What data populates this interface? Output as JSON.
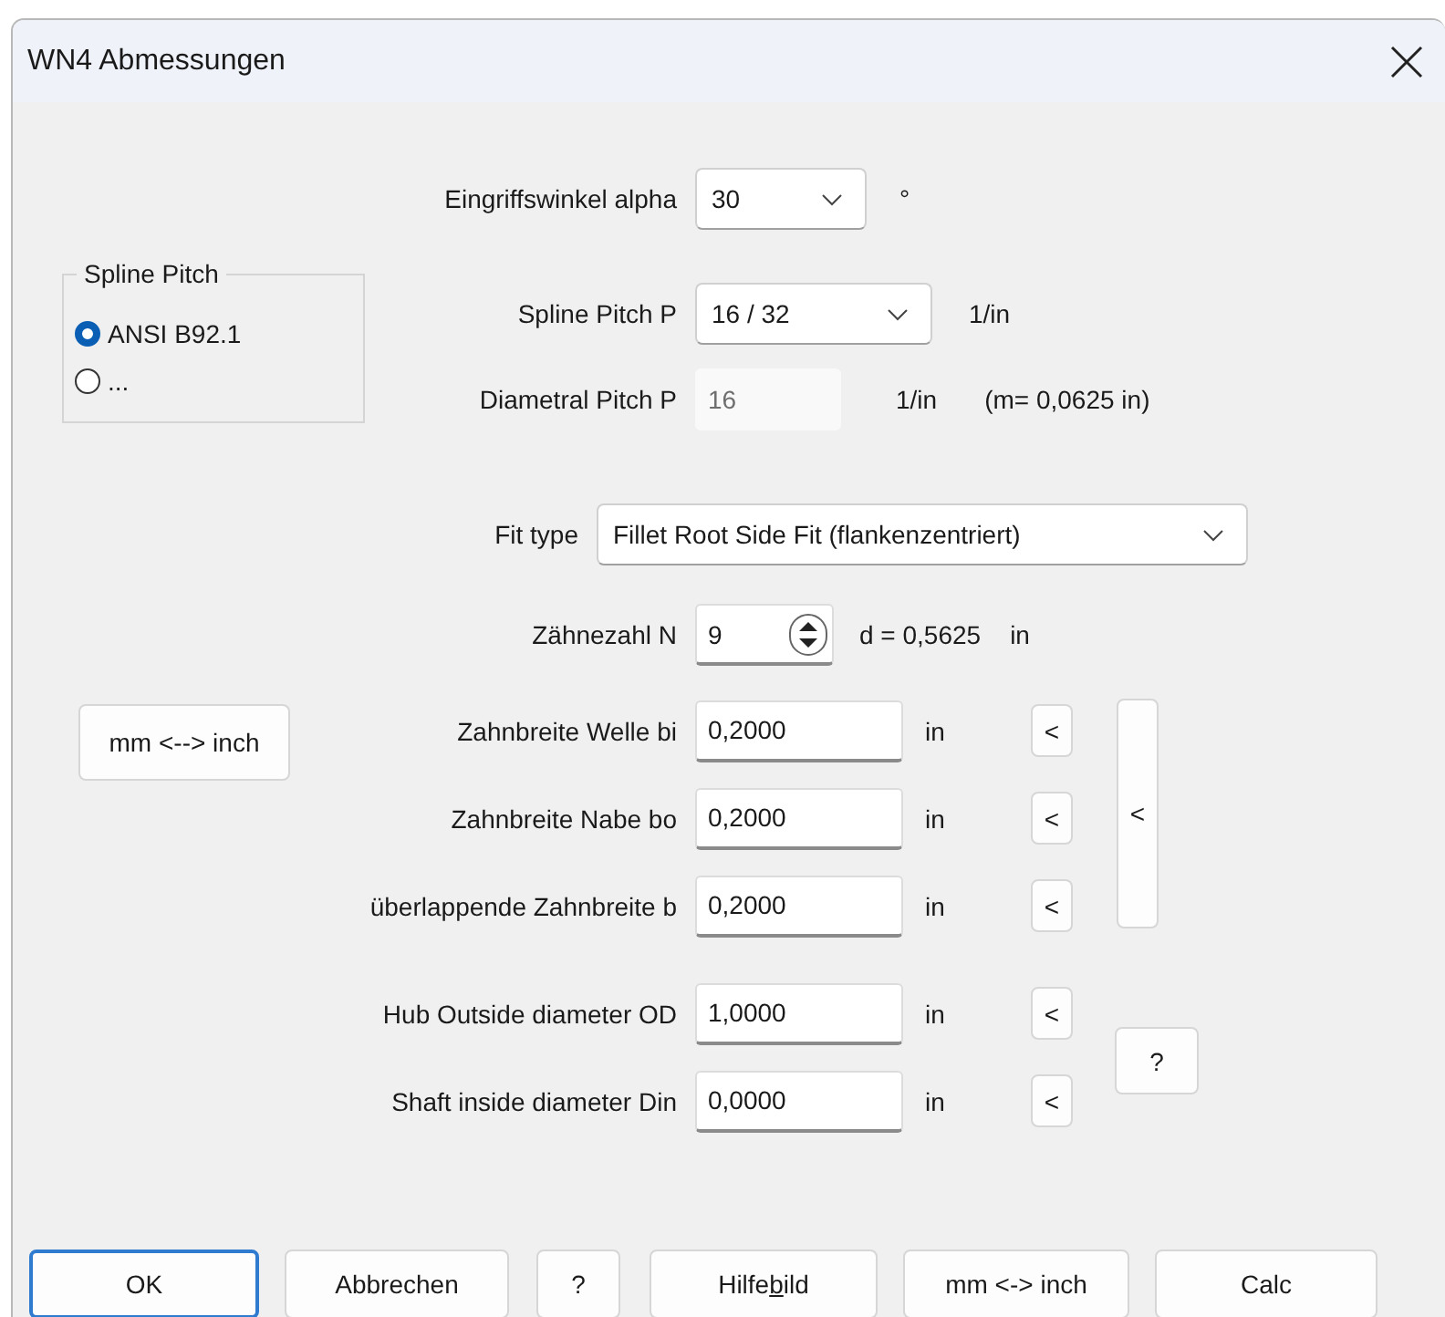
{
  "window": {
    "title": "WN4 Abmessungen"
  },
  "pressure_angle": {
    "label": "Eingriffswinkel alpha",
    "value": "30",
    "unit": "°"
  },
  "spline_pitch_group": {
    "title": "Spline Pitch",
    "options": [
      {
        "label": "ANSI B92.1",
        "selected": true
      },
      {
        "label": "...",
        "selected": false
      }
    ]
  },
  "spline_pitch": {
    "label": "Spline Pitch P",
    "value": "16 / 32",
    "unit": "1/in"
  },
  "diametral_pitch": {
    "label": "Diametral Pitch P",
    "value": "16",
    "disabled": true,
    "unit": "1/in",
    "module": "(m= 0,0625 in)"
  },
  "fit_type": {
    "label": "Fit type",
    "value": "Fillet Root Side Fit (flankenzentriert)"
  },
  "teeth": {
    "label": "Zähnezahl N",
    "value": "9",
    "diameter": "d = 0,5625",
    "unit": "in"
  },
  "convert_button": "mm <--> inch",
  "width_rows": [
    {
      "label": "Zahnbreite Welle bi",
      "value": "0,2000",
      "unit": "in",
      "button": "<"
    },
    {
      "label": "Zahnbreite Nabe bo",
      "value": "0,2000",
      "unit": "in",
      "button": "<"
    },
    {
      "label": "überlappende Zahnbreite b",
      "value": "0,2000",
      "unit": "in",
      "button": "<"
    }
  ],
  "copy_all_button": "<",
  "diameter_rows": [
    {
      "label": "Hub Outside diameter OD",
      "value": "1,0000",
      "unit": "in",
      "button": "<"
    },
    {
      "label": "Shaft inside diameter  Din",
      "value": "0,0000",
      "unit": "in",
      "button": "<"
    }
  ],
  "help_button": "?",
  "buttons": [
    {
      "kind": "plain",
      "label": "OK",
      "default": true
    },
    {
      "kind": "plain",
      "label": "Abbrechen",
      "default": false
    },
    {
      "kind": "plain",
      "label": "?",
      "default": false
    },
    {
      "kind": "accel",
      "label": "Hilfe",
      "accel": "b",
      "label_after": "ild",
      "default": false
    },
    {
      "kind": "plain",
      "label": "mm <-> inch",
      "default": false
    },
    {
      "kind": "plain",
      "label": "Calc",
      "default": false
    }
  ]
}
